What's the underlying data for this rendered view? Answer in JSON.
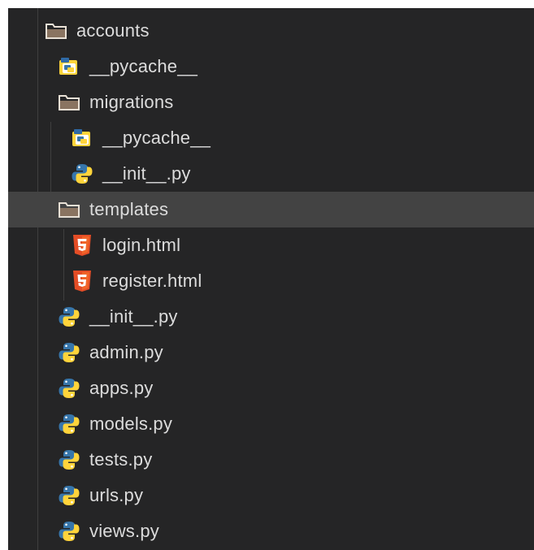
{
  "explorer": {
    "items": [
      {
        "label": "accounts",
        "icon": "folder-icon",
        "depth": 0
      },
      {
        "label": "__pycache__",
        "icon": "pycache-folder-icon",
        "depth": 1
      },
      {
        "label": "migrations",
        "icon": "folder-icon",
        "depth": 1
      },
      {
        "label": "__pycache__",
        "icon": "pycache-folder-icon",
        "depth": 2
      },
      {
        "label": "__init__.py",
        "icon": "python-icon",
        "depth": 2
      },
      {
        "label": "templates",
        "icon": "folder-icon",
        "depth": 1,
        "selected": true
      },
      {
        "label": "login.html",
        "icon": "html5-icon",
        "depth": 2
      },
      {
        "label": "register.html",
        "icon": "html5-icon",
        "depth": 2
      },
      {
        "label": "__init__.py",
        "icon": "python-icon",
        "depth": 1
      },
      {
        "label": "admin.py",
        "icon": "python-icon",
        "depth": 1
      },
      {
        "label": "apps.py",
        "icon": "python-icon",
        "depth": 1
      },
      {
        "label": "models.py",
        "icon": "python-icon",
        "depth": 1
      },
      {
        "label": "tests.py",
        "icon": "python-icon",
        "depth": 1
      },
      {
        "label": "urls.py",
        "icon": "python-icon",
        "depth": 1
      },
      {
        "label": "views.py",
        "icon": "python-icon",
        "depth": 1
      }
    ]
  },
  "colors": {
    "background": "#252526",
    "selected": "#434343",
    "text": "#dcdcdc",
    "html5": "#e44d26",
    "python_blue": "#3776ab",
    "python_yellow": "#ffd43b"
  }
}
